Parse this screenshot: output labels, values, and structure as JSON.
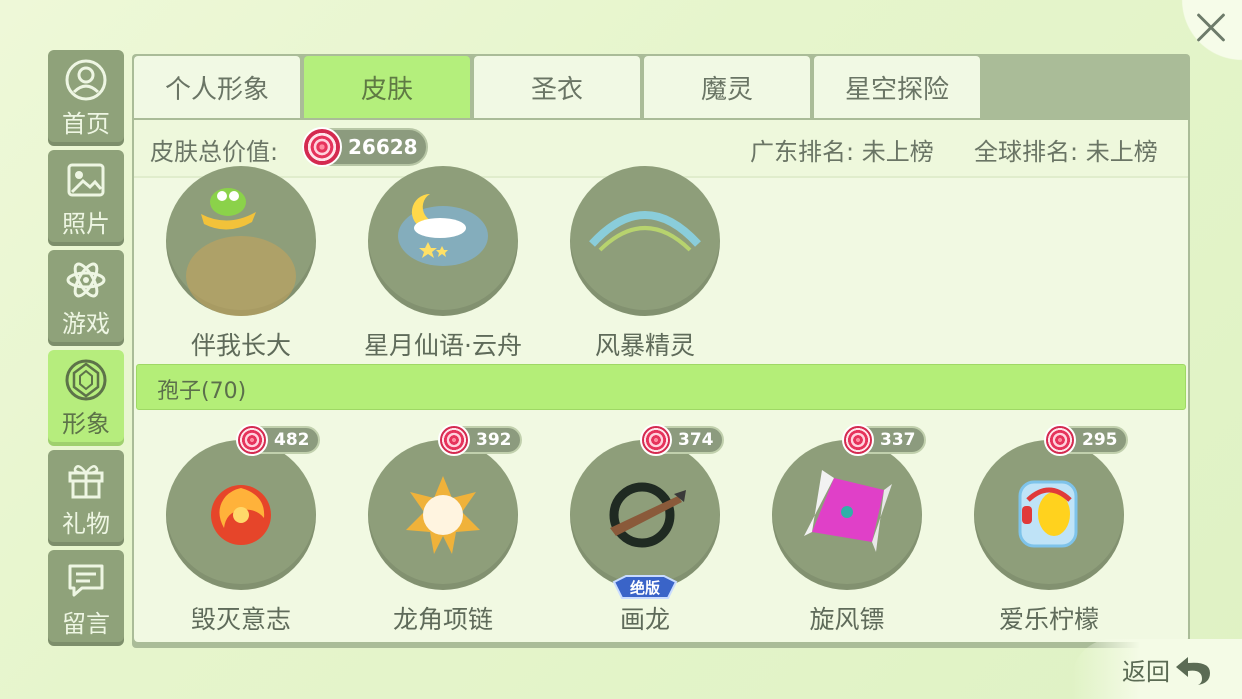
{
  "sidebar": {
    "items": [
      {
        "label": "首页",
        "icon": "user-icon"
      },
      {
        "label": "照片",
        "icon": "photo-icon"
      },
      {
        "label": "游戏",
        "icon": "atom-icon"
      },
      {
        "label": "形象",
        "icon": "diamond-icon",
        "active": true
      },
      {
        "label": "礼物",
        "icon": "gift-icon"
      },
      {
        "label": "留言",
        "icon": "message-icon"
      }
    ]
  },
  "tabs": [
    {
      "label": "个人形象"
    },
    {
      "label": "皮肤",
      "active": true
    },
    {
      "label": "圣衣"
    },
    {
      "label": "魔灵"
    },
    {
      "label": "星空探险"
    }
  ],
  "info": {
    "total_label": "皮肤总价值:",
    "total_value": "26628",
    "guangdong_rank": "广东排名: 未上榜",
    "global_rank": "全球排名: 未上榜"
  },
  "owned_items": [
    {
      "name": "伴我长大"
    },
    {
      "name": "星月仙语·云舟"
    },
    {
      "name": "风暴精灵"
    }
  ],
  "section": {
    "label": "孢子(70)"
  },
  "shop_items": [
    {
      "name": "毁灭意志",
      "price": "482"
    },
    {
      "name": "龙角项链",
      "price": "392"
    },
    {
      "name": "画龙",
      "price": "374",
      "badge": "绝版"
    },
    {
      "name": "旋风镖",
      "price": "337"
    },
    {
      "name": "爱乐柠檬",
      "price": "295"
    }
  ],
  "back_label": "返回",
  "colors": {
    "active_green": "#b4ef7c",
    "sidebar_bg": "#8fa27a",
    "circle_bg": "#8e9e7a"
  }
}
